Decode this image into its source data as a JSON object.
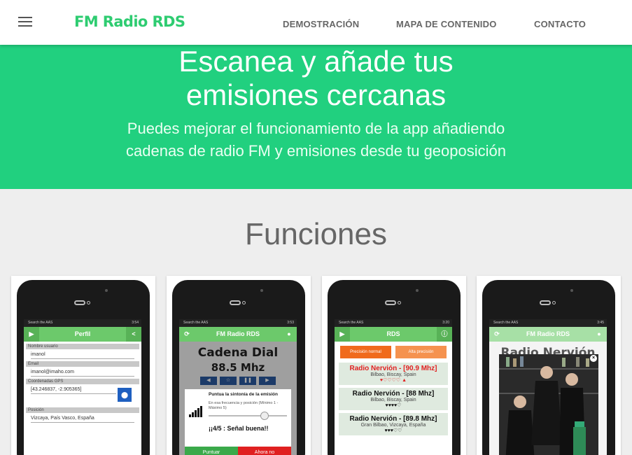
{
  "nav": {
    "brand": "FM Radio RDS",
    "links": [
      "DEMOSTRACIÓN",
      "MAPA DE CONTENIDO",
      "CONTACTO"
    ]
  },
  "hero": {
    "title_line1": "Escanea y añade tus",
    "title_line2": "emisiones cercanas",
    "subtitle_line1": "Puedes mejorar el funcionamiento de la app añadiendo",
    "subtitle_line2": "cadenas de radio FM y emisiones desde tu geoposición"
  },
  "section": {
    "title": "Funciones"
  },
  "colors": {
    "brand": "#2ecc71",
    "hero_bg": "#21d07f",
    "app_green": "#6cc96b",
    "orange": "#f06a1c",
    "red": "#e02020",
    "blue": "#1e5fc0"
  },
  "phones": {
    "statusbar_text": "Search the AAS",
    "profile": {
      "time": "3:54",
      "title": "Perfil",
      "fields": [
        {
          "label": "Nombre usuario",
          "value": "imanol"
        },
        {
          "label": "Email",
          "value": "imanol@imaho.com"
        },
        {
          "label": "Coordenadas GPS",
          "value": "[43.246837, -2.905365]"
        },
        {
          "label": "Posición",
          "value": "Vizcaya, País Vasco, España"
        }
      ]
    },
    "dial": {
      "time": "3:53",
      "title": "FM Radio RDS",
      "station": "Cadena Dial",
      "freq": "88.5 Mhz",
      "dialog_title": "Puntua la sintonía de la emisión",
      "dialog_sub": "En esa frecuencia y posición (Mínimo 1 - Máximo 5)",
      "score": "¡¡4/5 : Señal buena!!",
      "btn_ok": "Puntuar",
      "btn_cancel": "Ahora no"
    },
    "rds": {
      "time": "3:20",
      "title": "RDS",
      "btn_normal": "Precisión normal",
      "btn_high": "Alta precisión",
      "items": [
        {
          "name": "Radio Nervión - [90.9 Mhz]",
          "loc": "Bilbao, Biscay, Spain",
          "hearts": "♥♡♡♡♡ ▲"
        },
        {
          "name": "Radio Nervión - [88 Mhz]",
          "loc": "Bilbao, Biscay, Spain",
          "hearts": "♥♥♥♥♡"
        },
        {
          "name": "Radio Nervión - [89.8 Mhz]",
          "loc": "Gran Bilbao, Vizcaya, España",
          "hearts": "♥♥♥♡♡"
        }
      ]
    },
    "nervion": {
      "time": "3:45",
      "title": "FM Radio RDS",
      "station": "Radio Nervión"
    }
  }
}
